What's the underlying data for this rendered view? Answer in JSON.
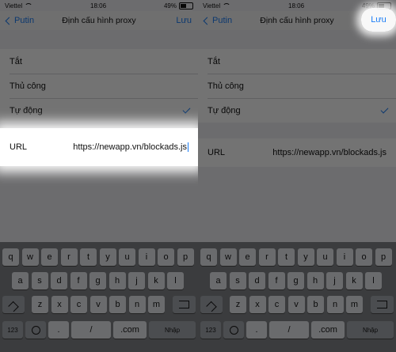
{
  "status": {
    "carrier": "Viettel",
    "time": "18:06",
    "battery": "49%"
  },
  "nav": {
    "back_label": "Putin",
    "title": "Định cấu hình proxy",
    "save_label": "Lưu"
  },
  "options": [
    {
      "label": "Tắt",
      "checked": false
    },
    {
      "label": "Thủ công",
      "checked": false
    },
    {
      "label": "Tự động",
      "checked": true
    }
  ],
  "url": {
    "label": "URL",
    "value": "https://newapp.vn/blockads.js"
  },
  "keyboard": {
    "row1": [
      "q",
      "w",
      "e",
      "r",
      "t",
      "y",
      "u",
      "i",
      "o",
      "p"
    ],
    "row2": [
      "a",
      "s",
      "d",
      "f",
      "g",
      "h",
      "j",
      "k",
      "l"
    ],
    "row3": [
      "z",
      "x",
      "c",
      "v",
      "b",
      "n",
      "m"
    ],
    "num_label": "123",
    "slash_label": "/",
    "com_label": ".com",
    "return_label": "Nhập",
    "dot_label": "."
  },
  "icons": [
    "wifi-icon",
    "battery-icon",
    "chevron-left-icon",
    "checkmark-icon",
    "shift-icon",
    "backspace-icon",
    "globe-icon"
  ]
}
